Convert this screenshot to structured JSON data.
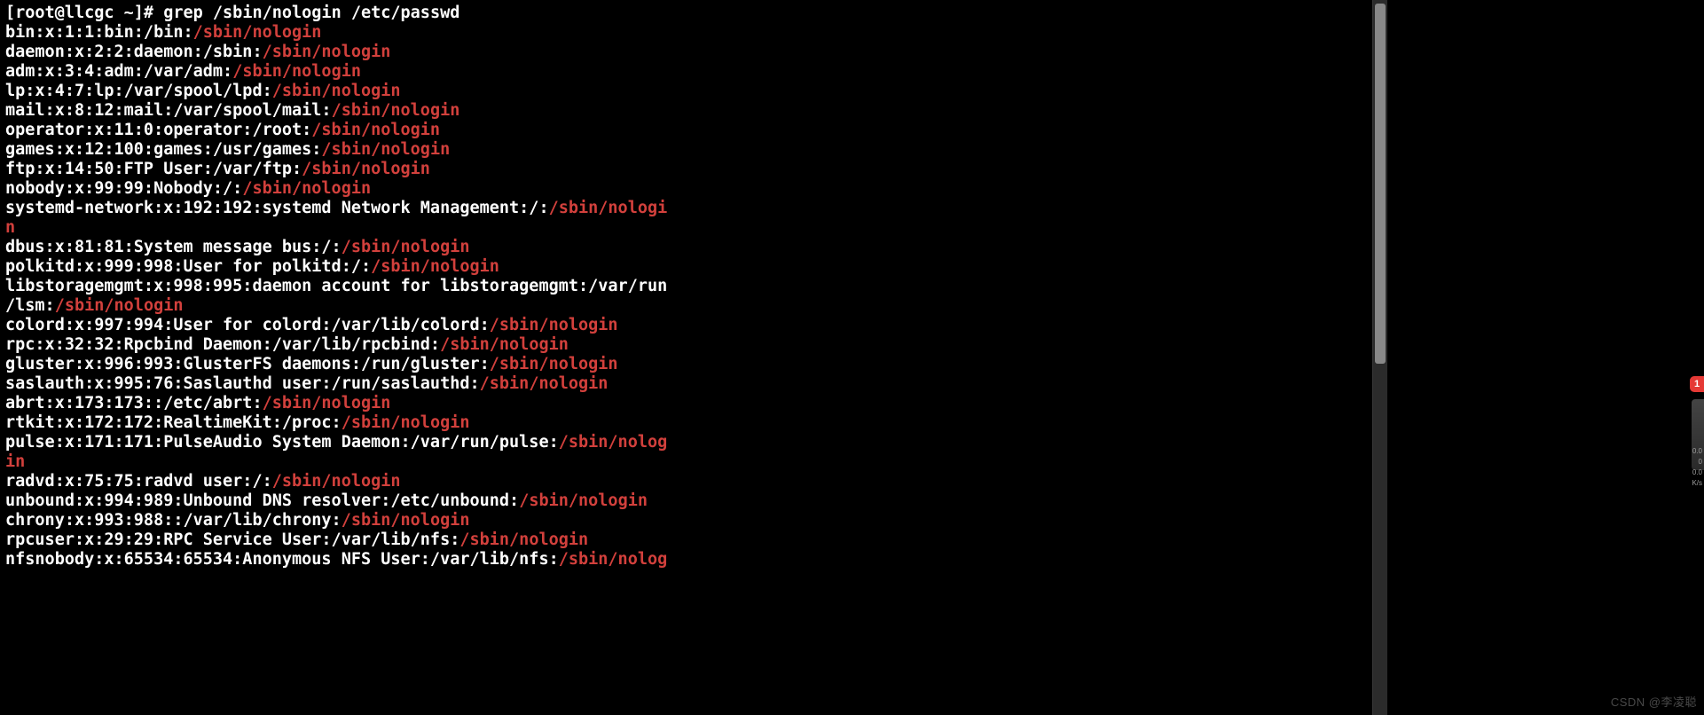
{
  "terminal": {
    "prompt": "[root@llcgc ~]# ",
    "command": "grep /sbin/nologin /etc/passwd",
    "match": "/sbin/nologin",
    "lines": [
      {
        "pre": "bin:x:1:1:bin:/bin:",
        "match": "/sbin/nologin",
        "post": ""
      },
      {
        "pre": "daemon:x:2:2:daemon:/sbin:",
        "match": "/sbin/nologin",
        "post": ""
      },
      {
        "pre": "adm:x:3:4:adm:/var/adm:",
        "match": "/sbin/nologin",
        "post": ""
      },
      {
        "pre": "lp:x:4:7:lp:/var/spool/lpd:",
        "match": "/sbin/nologin",
        "post": ""
      },
      {
        "pre": "mail:x:8:12:mail:/var/spool/mail:",
        "match": "/sbin/nologin",
        "post": ""
      },
      {
        "pre": "operator:x:11:0:operator:/root:",
        "match": "/sbin/nologin",
        "post": ""
      },
      {
        "pre": "games:x:12:100:games:/usr/games:",
        "match": "/sbin/nologin",
        "post": ""
      },
      {
        "pre": "ftp:x:14:50:FTP User:/var/ftp:",
        "match": "/sbin/nologin",
        "post": ""
      },
      {
        "pre": "nobody:x:99:99:Nobody:/:",
        "match": "/sbin/nologin",
        "post": ""
      },
      {
        "pre": "systemd-network:x:192:192:systemd Network Management:/:",
        "match": "/sbin/nologi",
        "post": "",
        "wrap": true
      },
      {
        "pre": "",
        "match": "n",
        "post": ""
      },
      {
        "pre": "dbus:x:81:81:System message bus:/:",
        "match": "/sbin/nologin",
        "post": ""
      },
      {
        "pre": "polkitd:x:999:998:User for polkitd:/:",
        "match": "/sbin/nologin",
        "post": ""
      },
      {
        "pre": "libstoragemgmt:x:998:995:daemon account for libstoragemgmt:/var/run",
        "match": "",
        "post": "",
        "wrap": true
      },
      {
        "pre": "/lsm:",
        "match": "/sbin/nologin",
        "post": ""
      },
      {
        "pre": "colord:x:997:994:User for colord:/var/lib/colord:",
        "match": "/sbin/nologin",
        "post": ""
      },
      {
        "pre": "rpc:x:32:32:Rpcbind Daemon:/var/lib/rpcbind:",
        "match": "/sbin/nologin",
        "post": ""
      },
      {
        "pre": "gluster:x:996:993:GlusterFS daemons:/run/gluster:",
        "match": "/sbin/nologin",
        "post": ""
      },
      {
        "pre": "saslauth:x:995:76:Saslauthd user:/run/saslauthd:",
        "match": "/sbin/nologin",
        "post": ""
      },
      {
        "pre": "abrt:x:173:173::/etc/abrt:",
        "match": "/sbin/nologin",
        "post": ""
      },
      {
        "pre": "rtkit:x:172:172:RealtimeKit:/proc:",
        "match": "/sbin/nologin",
        "post": ""
      },
      {
        "pre": "pulse:x:171:171:PulseAudio System Daemon:/var/run/pulse:",
        "match": "/sbin/nolog",
        "post": "",
        "wrap": true
      },
      {
        "pre": "",
        "match": "in",
        "post": ""
      },
      {
        "pre": "radvd:x:75:75:radvd user:/:",
        "match": "/sbin/nologin",
        "post": ""
      },
      {
        "pre": "unbound:x:994:989:Unbound DNS resolver:/etc/unbound:",
        "match": "/sbin/nologin",
        "post": ""
      },
      {
        "pre": "chrony:x:993:988::/var/lib/chrony:",
        "match": "/sbin/nologin",
        "post": ""
      },
      {
        "pre": "rpcuser:x:29:29:RPC Service User:/var/lib/nfs:",
        "match": "/sbin/nologin",
        "post": ""
      },
      {
        "pre": "nfsnobody:x:65534:65534:Anonymous NFS User:/var/lib/nfs:",
        "match": "/sbin/nolog",
        "post": ""
      }
    ]
  },
  "side": {
    "badge": "1",
    "metrics": [
      "0.0",
      "0",
      "0.0",
      "K/s"
    ]
  },
  "watermark": "CSDN @李凌聪"
}
